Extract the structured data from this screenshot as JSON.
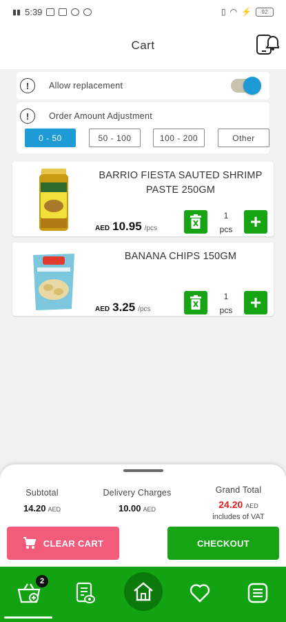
{
  "status_bar": {
    "time": "5:39",
    "battery": "92"
  },
  "header": {
    "title": "Cart"
  },
  "options": {
    "allow_replacement": {
      "label": "Allow replacement",
      "enabled": true
    },
    "order_adjustment": {
      "label": "Order Amount Adjustment",
      "choices": [
        "0 - 50",
        "50 - 100",
        "100 - 200",
        "Other"
      ],
      "selected": "0 - 50"
    }
  },
  "products": [
    {
      "name": "BARRIO FIESTA SAUTED SHRIMP PASTE 250GM",
      "currency": "AED",
      "price": "10.95",
      "unit": "/pcs",
      "qty": "1",
      "qty_unit": "pcs"
    },
    {
      "name": "BANANA CHIPS 150GM",
      "currency": "AED",
      "price": "3.25",
      "unit": "/pcs",
      "qty": "1",
      "qty_unit": "pcs"
    }
  ],
  "summary": {
    "subtotal_label": "Subtotal",
    "subtotal_value": "14.20",
    "delivery_label": "Delivery Charges",
    "delivery_value": "10.00",
    "currency": "AED",
    "grand_label": "Grand Total",
    "grand_value": "24.20",
    "grand_currency": "AED",
    "vat_note": "includes of VAT"
  },
  "actions": {
    "clear_label": "CLEAR CART",
    "checkout_label": "CHECKOUT"
  },
  "nav": {
    "cart_badge": "2"
  },
  "colors": {
    "accent_blue": "#1e9bd7",
    "green": "#16a415",
    "pink": "#f25c7a",
    "total_red": "#e01b1b"
  }
}
